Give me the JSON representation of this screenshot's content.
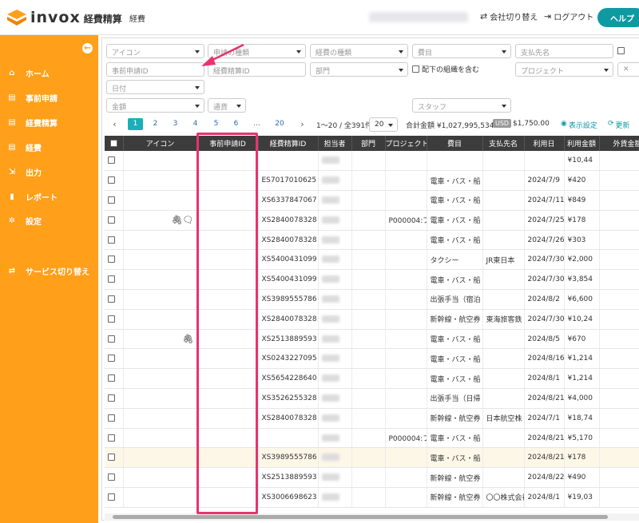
{
  "header": {
    "logo_text": "invox",
    "logo_sub": "経費精算",
    "menu_label": "経費",
    "switch_company": "会社切り替え",
    "logout": "ログアウト",
    "help": "ヘルプ"
  },
  "sidebar": {
    "items": [
      {
        "label": "ホーム",
        "icon": "home-icon"
      },
      {
        "label": "事前申請",
        "icon": "document-icon"
      },
      {
        "label": "経費精算",
        "icon": "document-icon"
      },
      {
        "label": "経費",
        "icon": "document-icon"
      },
      {
        "label": "出力",
        "icon": "export-icon"
      },
      {
        "label": "レポート",
        "icon": "chart-icon"
      },
      {
        "label": "設定",
        "icon": "gear-icon"
      },
      {
        "label": "サービス切り替え",
        "icon": "switch-icon"
      }
    ]
  },
  "filters": {
    "icon": "アイコン",
    "application_type": "申請の種類",
    "expense_type": "経費の種類",
    "expense_item": "費目",
    "payee": "支払先名",
    "pre_app_id": "事前申請ID",
    "settlement_id": "経費精算ID",
    "department": "部門",
    "include_sub": "配下の組織を含む",
    "project": "プロジェクト",
    "date": "日付",
    "amount": "金額",
    "currency": "通貨",
    "staff": "スタッフ"
  },
  "pagination": {
    "pages": [
      "1",
      "2",
      "3",
      "4",
      "5",
      "6",
      "20"
    ],
    "ellipsis": "...",
    "range": "1〜20 / 全391件",
    "per_page": "20",
    "total_label": "合計金額 ¥1,027,995,534",
    "usd_badge": "USD",
    "usd_amount": "$1,750.00",
    "display_settings": "表示設定",
    "update": "更新"
  },
  "table": {
    "headers": [
      "アイコン",
      "事前申請ID",
      "経費精算ID",
      "担当者",
      "部門",
      "プロジェクト",
      "費目",
      "支払先名",
      "利用日",
      "利用金額",
      "外貨金額"
    ],
    "rows": [
      {
        "icons": "",
        "pre": "",
        "sid": "",
        "proj": "",
        "item": "",
        "payee": "",
        "date": "",
        "amt": "¥10,44"
      },
      {
        "icons": "",
        "pre": "",
        "sid": "ES7017010625",
        "proj": "",
        "item": "電車・バス・船",
        "payee": "",
        "date": "2024/7/9",
        "amt": "¥420"
      },
      {
        "icons": "",
        "pre": "",
        "sid": "XS6337847067",
        "proj": "",
        "item": "電車・バス・船",
        "payee": "",
        "date": "2024/7/11",
        "amt": "¥849"
      },
      {
        "icons": "clip-chat",
        "pre": "",
        "sid": "XS2840078328",
        "proj": "P000004:プ",
        "item": "電車・バス・船",
        "payee": "",
        "date": "2024/7/25",
        "amt": "¥178"
      },
      {
        "icons": "",
        "pre": "",
        "sid": "XS2840078328",
        "proj": "",
        "item": "電車・バス・船",
        "payee": "",
        "date": "2024/7/26",
        "amt": "¥303"
      },
      {
        "icons": "",
        "pre": "",
        "sid": "XS5400431099",
        "proj": "",
        "item": "タクシー",
        "payee": "JR東日本",
        "date": "2024/7/30",
        "amt": "¥2,000"
      },
      {
        "icons": "",
        "pre": "",
        "sid": "XS5400431099",
        "proj": "",
        "item": "電車・バス・船",
        "payee": "",
        "date": "2024/7/30",
        "amt": "¥3,854"
      },
      {
        "icons": "",
        "pre": "",
        "sid": "XS3989555786",
        "proj": "",
        "item": "出張手当（宿泊",
        "payee": "",
        "date": "2024/8/2",
        "amt": "¥6,600"
      },
      {
        "icons": "",
        "pre": "",
        "sid": "XS2840078328",
        "proj": "",
        "item": "新幹線・航空券",
        "payee": "東海旅客鉄",
        "date": "2024/7/30",
        "amt": "¥10,24"
      },
      {
        "icons": "clip",
        "pre": "",
        "sid": "XS2513889593",
        "proj": "",
        "item": "電車・バス・船",
        "payee": "",
        "date": "2024/8/5",
        "amt": "¥670"
      },
      {
        "icons": "",
        "pre": "",
        "sid": "XS0243227095",
        "proj": "",
        "item": "電車・バス・船",
        "payee": "",
        "date": "2024/8/16",
        "amt": "¥1,214"
      },
      {
        "icons": "",
        "pre": "",
        "sid": "XS5654228640",
        "proj": "",
        "item": "電車・バス・船",
        "payee": "",
        "date": "2024/8/1",
        "amt": "¥1,214"
      },
      {
        "icons": "",
        "pre": "",
        "sid": "XS3526255328",
        "proj": "",
        "item": "出張手当（日帰",
        "payee": "",
        "date": "2024/8/21",
        "amt": "¥4,000"
      },
      {
        "icons": "",
        "pre": "",
        "sid": "XS2840078328",
        "proj": "",
        "item": "新幹線・航空券",
        "payee": "日本航空株",
        "date": "2024/7/1",
        "amt": "¥18,74"
      },
      {
        "icons": "",
        "pre": "",
        "sid": "",
        "proj": "P000004:プ",
        "item": "電車・バス・船",
        "payee": "",
        "date": "2024/8/21",
        "amt": "¥5,170"
      },
      {
        "icons": "",
        "pre": "",
        "sid": "XS3989555786",
        "proj": "",
        "item": "電車・バス・船",
        "payee": "",
        "date": "2024/8/21",
        "amt": "¥178"
      },
      {
        "icons": "",
        "pre": "",
        "sid": "XS2513889593",
        "proj": "",
        "item": "新幹線・航空券",
        "payee": "",
        "date": "2024/8/22",
        "amt": "¥490"
      },
      {
        "icons": "",
        "pre": "",
        "sid": "XS3006698623",
        "proj": "",
        "item": "新幹線・航空券",
        "payee": "〇〇株式会社",
        "date": "2024/8/1",
        "amt": "¥19,03"
      }
    ]
  },
  "colors": {
    "sidebar": "#ff9f1a",
    "accent": "#1bb0b7",
    "highlight": "#e8336d"
  }
}
